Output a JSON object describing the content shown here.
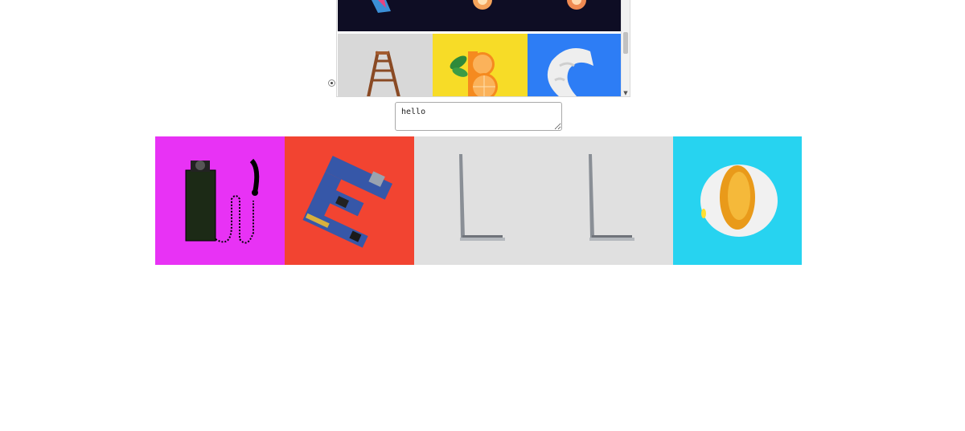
{
  "font_picker": {
    "preview_text": "hello",
    "tiles": [
      {
        "letter": "A",
        "style": "ladder",
        "background": "#d8d8d8"
      },
      {
        "letter": "B",
        "style": "orange slices",
        "background": "#f7dc27"
      },
      {
        "letter": "C",
        "style": "pillow",
        "background": "#2d7df5"
      }
    ]
  },
  "rendered_word": {
    "letters": [
      {
        "letter": "H",
        "style": "telephone",
        "background": "#e832f5"
      },
      {
        "letter": "E",
        "style": "circuit board",
        "background": "#f24431"
      },
      {
        "letter": "L",
        "style": "laptop",
        "background": "#e0e0e0"
      },
      {
        "letter": "L",
        "style": "laptop",
        "background": "#e0e0e0"
      },
      {
        "letter": "O",
        "style": "egg",
        "background": "#27d3f0"
      }
    ]
  }
}
